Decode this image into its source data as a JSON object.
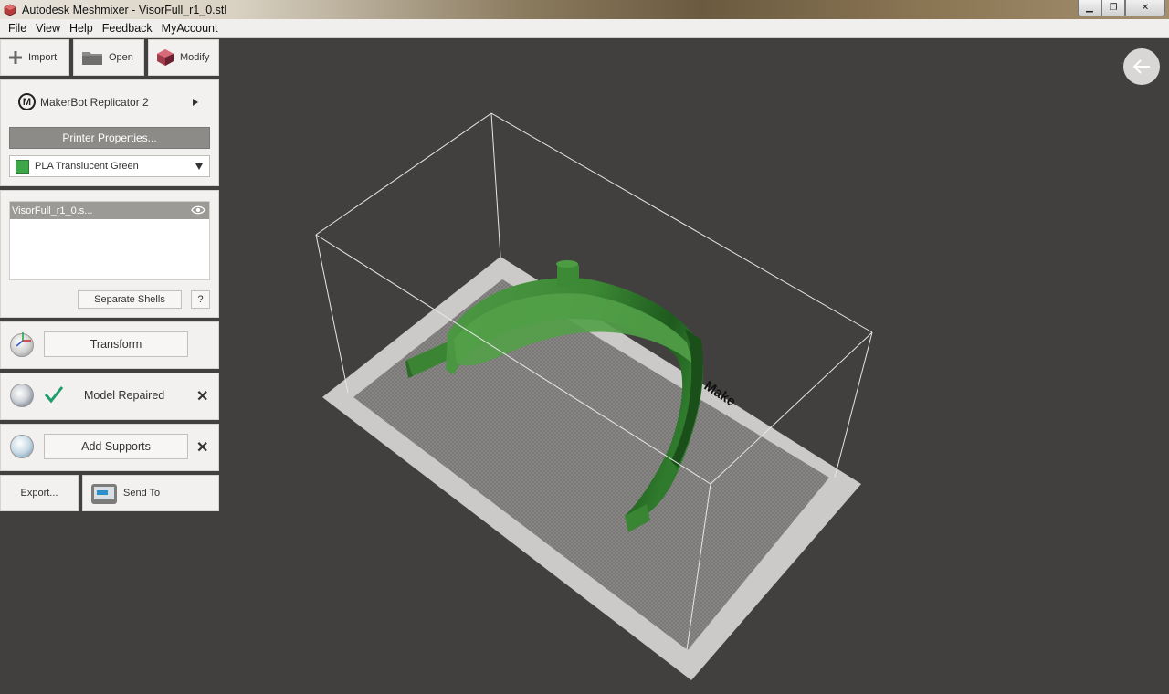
{
  "window": {
    "title": "Autodesk Meshmixer - VisorFull_r1_0.stl",
    "controls": {
      "minimize": "▁",
      "maximize": "❐",
      "close": "✕"
    }
  },
  "menu": [
    "File",
    "View",
    "Help",
    "Feedback",
    "MyAccount"
  ],
  "toolbar": {
    "import_label": "Import",
    "open_label": "Open",
    "modify_label": "Modify"
  },
  "printer": {
    "name": "MakerBot Replicator 2",
    "logo": "M",
    "properties_label": "Printer Properties...",
    "material": "PLA Translucent Green",
    "material_color": "#3ca649"
  },
  "objects": {
    "items": [
      "VisorFull_r1_0.s..."
    ],
    "separate_label": "Separate Shells",
    "help_label": "?"
  },
  "transform": {
    "label": "Transform"
  },
  "repair": {
    "label": "Model Repaired",
    "status_color": "#1f9c6b"
  },
  "supports": {
    "label": "Add Supports"
  },
  "export": {
    "export_label": "Export...",
    "send_label": "Send To"
  },
  "viewport": {
    "bed_label": "Make",
    "model_color": "#3f8f3a",
    "background": "#41403e"
  }
}
